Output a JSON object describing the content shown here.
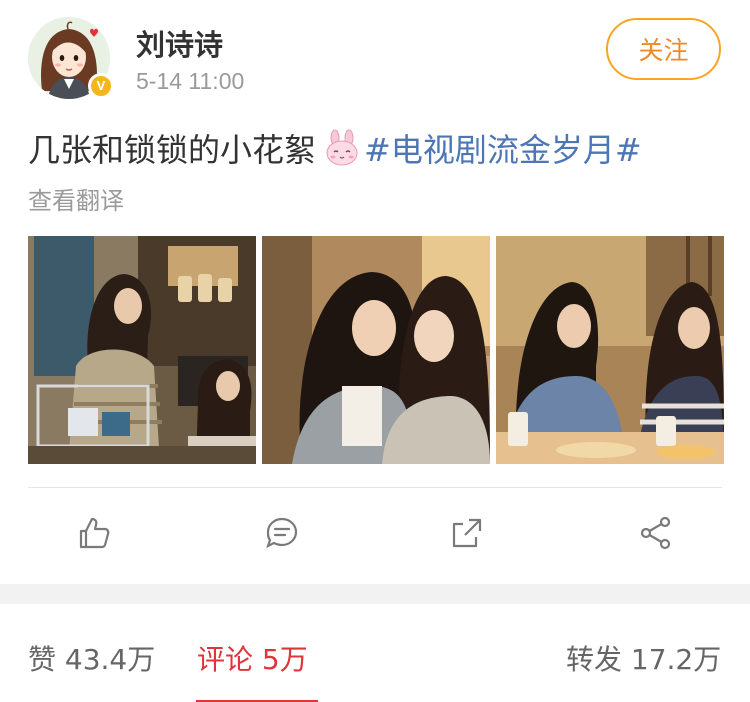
{
  "post": {
    "username": "刘诗诗",
    "timestamp": "5-14 11:00",
    "follow_label": "关注",
    "text_prefix": "几张和锁锁的小花絮",
    "emoji_name": "bunny-face-emoji",
    "hashtag": "#电视剧流金岁月#",
    "translate_label": "查看翻译",
    "photos": [
      {
        "name": "photo-1",
        "description_icon": "kitchen-scene"
      },
      {
        "name": "photo-2",
        "description_icon": "embrace-scene"
      },
      {
        "name": "photo-3",
        "description_icon": "dinner-scene"
      }
    ],
    "actions": [
      "like-icon",
      "comment-icon",
      "share-icon",
      "more-share-icon"
    ]
  },
  "stats": {
    "likes": "赞 43.4万",
    "comments": "评论 5万",
    "reposts": "转发 17.2万"
  },
  "colors": {
    "accent_orange": "#f08a24",
    "hashtag_blue": "#4d76b4",
    "active_red": "#e0343a",
    "verified_gold": "#f5b61b"
  }
}
